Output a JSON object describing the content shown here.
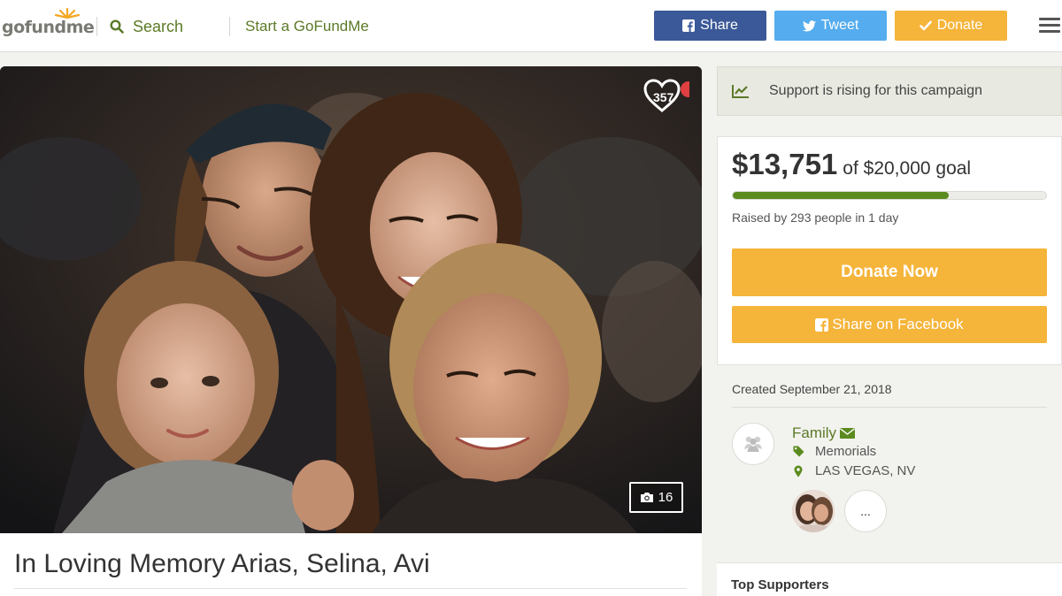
{
  "header": {
    "logo_text": "gofundme",
    "search_label": "Search",
    "start_label": "Start a GoFundMe",
    "share_label": "Share",
    "tweet_label": "Tweet",
    "donate_label": "Donate",
    "icons": {
      "search": "search-icon",
      "facebook": "facebook-icon",
      "twitter": "twitter-icon",
      "check": "check-icon",
      "menu": "hamburger-menu-icon"
    }
  },
  "hero": {
    "heart_count": "357",
    "photo_count": "16",
    "title": "In Loving Memory Arias, Selina, Avi"
  },
  "sidebar": {
    "rising_text": "Support is rising for this campaign",
    "raised_amount": "$13,751",
    "goal_text": "of $20,000 goal",
    "progress_fraction": 0.69,
    "raised_by": "Raised by 293 people in 1 day",
    "donate_now_label": "Donate Now",
    "share_facebook_label": "Share on Facebook",
    "created": "Created September 21, 2018",
    "organizer_name": "Family",
    "category": "Memorials",
    "location": "LAS VEGAS, NV",
    "more_label": "...",
    "top_supporters_label": "Top Supporters"
  },
  "colors": {
    "brand_green": "#5b7a27",
    "progress_green": "#5b8a1e",
    "facebook_blue": "#3b5998",
    "twitter_blue": "#55acee",
    "donate_orange": "#f5b43a"
  }
}
